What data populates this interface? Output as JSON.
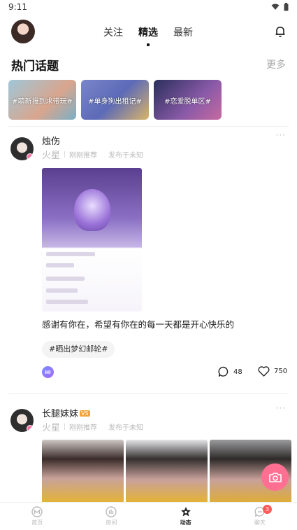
{
  "status_bar": {
    "time": "9:11"
  },
  "header": {
    "tabs": [
      {
        "label": "关注",
        "active": false
      },
      {
        "label": "精选",
        "active": true
      },
      {
        "label": "最新",
        "active": false
      }
    ]
  },
  "hot_topics": {
    "title": "热门话题",
    "more_label": "更多",
    "items": [
      {
        "label": "#萌新报到求带玩#"
      },
      {
        "label": "#单身狗出租记#"
      },
      {
        "label": "#恋爱脱单区#"
      }
    ]
  },
  "posts": [
    {
      "username": "烛伤",
      "planet": "火星",
      "recommend": "刚刚推荐",
      "published": "发布于未知",
      "text": "感谢有你在，希望有你在的每一天都是开心快乐的",
      "tag": "#晒出梦幻邮轮#",
      "hi_label": "HI",
      "comments": "48",
      "likes": "750"
    },
    {
      "username": "长腿妹妹",
      "badge": "VS",
      "planet": "火星",
      "recommend": "刚刚推荐",
      "published": "发布于未知"
    }
  ],
  "tabbar": {
    "items": [
      {
        "label": "首页",
        "icon": "home-icon"
      },
      {
        "label": "房间",
        "icon": "room-icon"
      },
      {
        "label": "动态",
        "icon": "moments-icon",
        "active": true
      },
      {
        "label": "聊天",
        "icon": "chat-icon",
        "badge": "3"
      }
    ]
  },
  "colors": {
    "accent": "#ff6f91",
    "badge_red": "#ff5a5a"
  }
}
